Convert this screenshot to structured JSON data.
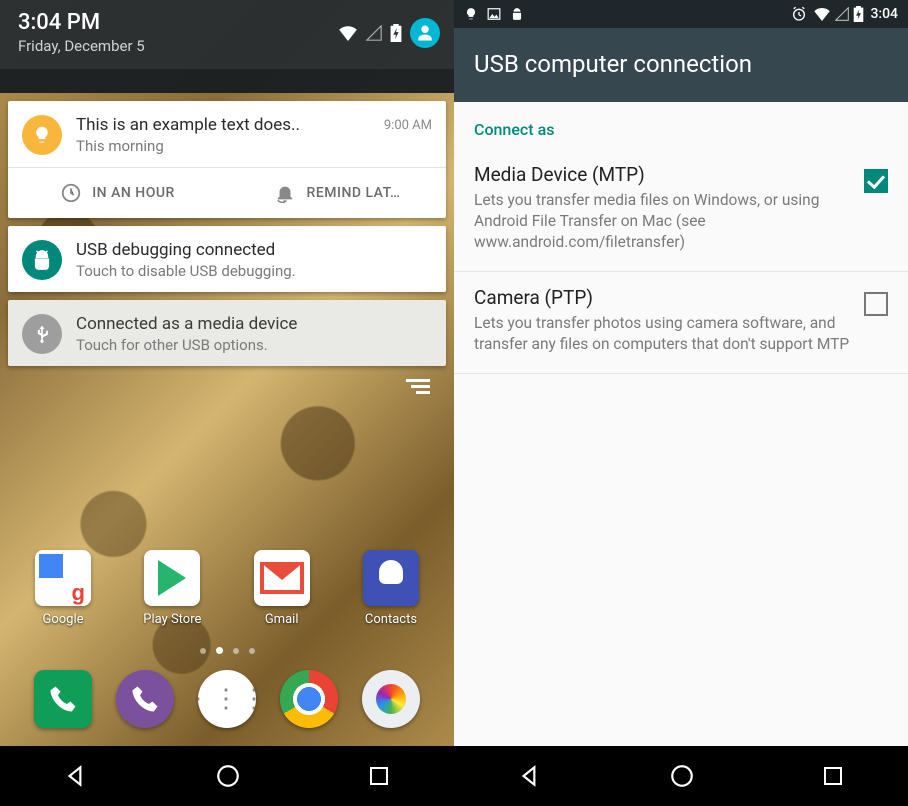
{
  "left": {
    "status": {
      "time": "3:04 PM",
      "date": "Friday, December 5"
    },
    "notifications": [
      {
        "icon": "bulb",
        "icon_color": "amber",
        "title": "This is an example text does..",
        "subtitle": "This morning",
        "time": "9:00 AM",
        "actions": [
          "IN AN HOUR",
          "REMIND LAT…"
        ]
      },
      {
        "icon": "android-debug",
        "icon_color": "teal",
        "title": "USB debugging connected",
        "subtitle": "Touch to disable USB debugging."
      },
      {
        "icon": "usb",
        "icon_color": "gray",
        "muted": true,
        "title": "Connected as a media device",
        "subtitle": "Touch for other USB options."
      }
    ],
    "home_apps": [
      {
        "label": "Google",
        "icon": "google"
      },
      {
        "label": "Play Store",
        "icon": "play"
      },
      {
        "label": "Gmail",
        "icon": "gmail"
      },
      {
        "label": "Contacts",
        "icon": "contacts"
      }
    ],
    "dock_apps": [
      {
        "icon": "phone"
      },
      {
        "icon": "viber"
      },
      {
        "icon": "apps"
      },
      {
        "icon": "chrome"
      },
      {
        "icon": "camera"
      }
    ]
  },
  "right": {
    "status_time": "3:04",
    "appbar_title": "USB computer connection",
    "section_label": "Connect as",
    "options": [
      {
        "title": "Media Device (MTP)",
        "desc": "Lets you transfer media files on Windows, or using Android File Transfer on Mac (see www.android.com/filetransfer)",
        "checked": true
      },
      {
        "title": "Camera (PTP)",
        "desc": "Lets you transfer photos using camera software, and transfer any files on computers that don't support MTP",
        "checked": false
      }
    ]
  }
}
